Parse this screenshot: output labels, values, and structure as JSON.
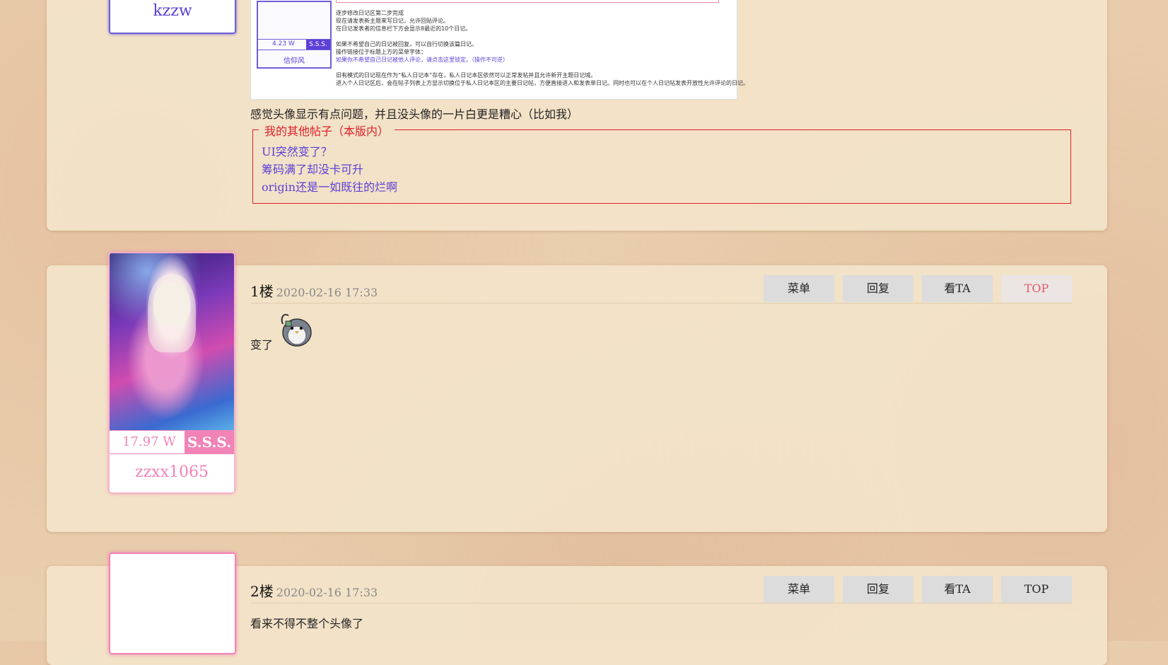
{
  "user0": {
    "name": "kzzw"
  },
  "screenshot": {
    "lines": [
      "逐步修改日记区第二步完成",
      "现在请发表新主题来写日记，允许回贴评论。",
      "在日记发表者的信息栏下方会显示8最近的10个日记。",
      "如果不希望自己的日记被回复，可以自行切换该篇日记。",
      "操作链接位于标题上方的菜单字体：",
      "如果你不希望自己日记被他人评论，请点击这里锁定。（操作不可逆）",
      "旧有模式的日记现在作为“私人日记本”存在，私人日记本区依然可以正常发帖并且允许新开主题日记域。",
      "进入个人日记区后，会在帖子列表上方显示切换位于私人日记本区的主要日记帖，方便直接进入和发表单日记。同时也可以在个人日记帖发表开放性允许评论的日记。"
    ],
    "mini_points": "4.23 W",
    "mini_rank": "S.S.S.",
    "mini_name": "信仰风"
  },
  "post0": {
    "text": "感觉头像显示有点问题，并且没头像的一片白更是糟心（比如我）",
    "other_posts_title": "我的其他帖子（本版内）",
    "other_posts": [
      "UI突然变了？",
      "筹码满了却没卡可升",
      "origin还是一如既往的烂啊"
    ]
  },
  "floor1": {
    "floor": "1楼",
    "date": "2020-02-16 17:33",
    "text": "变了",
    "user": {
      "points": "17.97 W",
      "rank": "S.S.S.",
      "name": "zzxx1065"
    },
    "buttons": [
      "菜单",
      "回复",
      "看TA",
      "TOP"
    ]
  },
  "floor2": {
    "floor": "2楼",
    "date": "2020-02-16 17:33",
    "text": "看来不得不整个头像了",
    "buttons": [
      "菜单",
      "回复",
      "看TA",
      "TOP"
    ]
  },
  "colors": {
    "pink": "#f283b6",
    "purple": "#5c3fd6",
    "red_border": "#e0202a"
  }
}
